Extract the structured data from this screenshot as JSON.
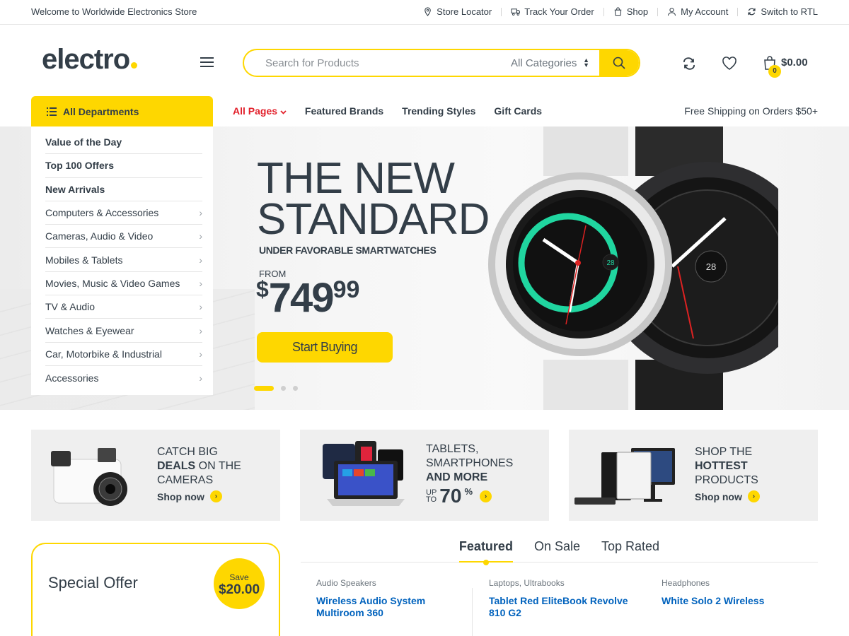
{
  "topbar": {
    "welcome": "Welcome to Worldwide Electronics Store",
    "links": [
      {
        "label": "Store Locator",
        "icon": "map-pin-icon"
      },
      {
        "label": "Track Your Order",
        "icon": "truck-icon"
      },
      {
        "label": "Shop",
        "icon": "shopping-bag-icon"
      },
      {
        "label": "My Account",
        "icon": "user-icon"
      },
      {
        "label": "Switch to RTL",
        "icon": "refresh-icon"
      }
    ]
  },
  "header": {
    "logo": "electro",
    "search": {
      "placeholder": "Search for Products",
      "category": "All Categories"
    },
    "cart": {
      "count": "0",
      "total": "$0.00"
    }
  },
  "nav": {
    "departments_label": "All Departments",
    "items": [
      "All Pages",
      "Featured Brands",
      "Trending Styles",
      "Gift Cards"
    ],
    "free_shipping": "Free Shipping on Orders $50+"
  },
  "departments": [
    {
      "label": "Value of the Day",
      "bold": true
    },
    {
      "label": "Top 100 Offers",
      "bold": true
    },
    {
      "label": "New Arrivals",
      "bold": true
    },
    {
      "label": "Computers & Accessories",
      "bold": false
    },
    {
      "label": "Cameras, Audio & Video",
      "bold": false
    },
    {
      "label": "Mobiles & Tablets",
      "bold": false
    },
    {
      "label": "Movies, Music & Video Games",
      "bold": false
    },
    {
      "label": "TV & Audio",
      "bold": false
    },
    {
      "label": "Watches & Eyewear",
      "bold": false
    },
    {
      "label": "Car, Motorbike & Industrial",
      "bold": false
    },
    {
      "label": "Accessories",
      "bold": false
    }
  ],
  "hero": {
    "title_line1": "THE NEW",
    "title_line2": "STANDARD",
    "subtitle": "UNDER FAVORABLE SMARTWATCHES",
    "from": "FROM",
    "price_currency": "$",
    "price_int": "749",
    "price_dec": "99",
    "button": "Start Buying",
    "slides": 3,
    "active_slide": 1,
    "watch_faces": [
      "28",
      "28"
    ]
  },
  "promos": [
    {
      "line1": "CATCH BIG",
      "bold": "DEALS",
      "line2_rest": " ON THE",
      "line3": "CAMERAS",
      "cta": "Shop now"
    },
    {
      "line1": "TABLETS,",
      "line2": "SMARTPHONES",
      "bold": "AND MORE",
      "upto": "UP",
      "to": "TO",
      "percent": "70",
      "pct_sign": "%"
    },
    {
      "line1": "SHOP THE",
      "bold": "HOTTEST",
      "line3": "PRODUCTS",
      "cta": "Shop now"
    }
  ],
  "special_offer": {
    "title": "Special Offer",
    "save_label": "Save",
    "save_value": "$20.00"
  },
  "tabs": [
    "Featured",
    "On Sale",
    "Top Rated"
  ],
  "products": [
    {
      "category": "Audio Speakers",
      "name": "Wireless Audio System Multiroom 360"
    },
    {
      "category": "Laptops, Ultrabooks",
      "name": "Tablet Red EliteBook Revolve 810 G2"
    },
    {
      "category": "Headphones",
      "name": "White Solo 2 Wireless"
    }
  ],
  "colors": {
    "accent": "#fed700",
    "text": "#333e48",
    "link": "#0062bd",
    "nav_red": "#e2202b"
  }
}
